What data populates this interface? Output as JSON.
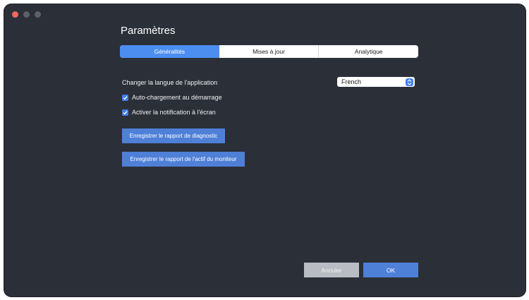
{
  "window": {
    "title": "Paramètres"
  },
  "tabs": [
    {
      "label": "Généralités",
      "active": true
    },
    {
      "label": "Mises à jour",
      "active": false
    },
    {
      "label": "Analytique",
      "active": false
    }
  ],
  "general": {
    "language_label": "Changer la langue de l'application",
    "language_value": "French",
    "options": [
      {
        "label": "Auto-chargement au démarrage",
        "checked": true
      },
      {
        "label": "Activer la notification à l'écran",
        "checked": true
      }
    ],
    "save_diagnostic_label": "Enregistrer le rapport de diagnostic",
    "save_asset_label": "Enregistrer le rapport de l'actif du moniteur"
  },
  "footer": {
    "cancel_label": "Annuler",
    "ok_label": "OK"
  },
  "colors": {
    "window_bg": "#2b2f38",
    "accent": "#4c8ef0",
    "button_blue": "#4f80d8",
    "button_disabled": "#b9bcc2",
    "close_dot": "#ec6a5e"
  },
  "icons": {
    "close": "close-dot-icon",
    "checkbox": "checkmark-icon",
    "select": "chevron-updown-icon"
  }
}
